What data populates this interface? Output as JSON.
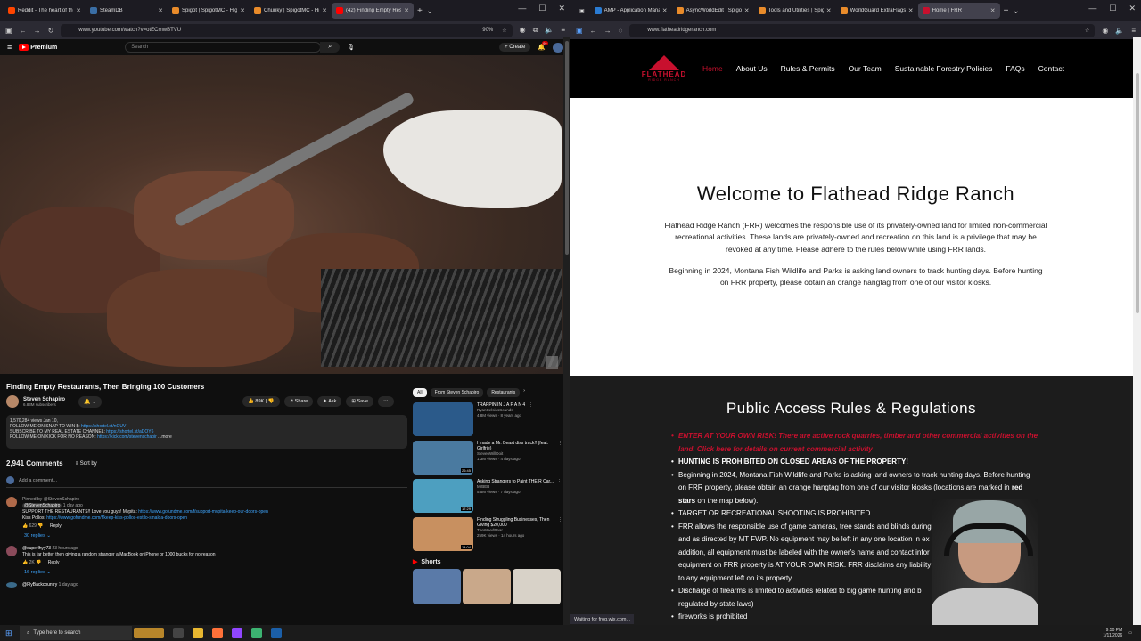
{
  "left_browser": {
    "tabs": [
      {
        "label": "Reddit - The heart of the",
        "color": "#ff4500",
        "active": false
      },
      {
        "label": "SteamDB",
        "color": "#3a6ea5",
        "active": false
      },
      {
        "label": "Spigot | SpigotMC - High",
        "color": "#e98b2a",
        "active": false
      },
      {
        "label": "Chunky | SpigotMC - High",
        "color": "#e98b2a",
        "active": false
      },
      {
        "label": "(42) Finding Empty Resta",
        "color": "#ff0000",
        "active": true
      }
    ],
    "url": "www.youtube.com/watch?v=otECrnwBTVU",
    "zoom": "90%"
  },
  "youtube": {
    "logo": "Premium",
    "search_placeholder": "Search",
    "create": "Create",
    "notif_count": "9+",
    "title": "Finding Empty Restaurants, Then Bringing 100 Customers",
    "channel": "Steven Schapiro",
    "subscribers": "6.83M subscribers",
    "likes": "89K",
    "share": "Share",
    "ask": "Ask",
    "save": "Save",
    "desc_line1": "1,570,284 views  Jan 10,",
    "desc_line2": "FOLLOW ME ON SNAP TO WIN $:",
    "desc_link2": "https://shortel.st/nGUV",
    "desc_line3": "SUBSCRIBE TO MY REAL ESTATE CHANNEL:",
    "desc_link3": "https://shortel.st/aDOY6",
    "desc_line4": "FOLLOW ME ON KICK FOR NO REASON:",
    "desc_link4": "https://kick.com/stevenschapir",
    "more": "...more",
    "comments_count": "2,941 Comments",
    "sort": "Sort by",
    "add_comment": "Add a comment...",
    "comments": [
      {
        "meta": "Pinned by @StevenSchapiro",
        "author": "@StevenSchapiro",
        "time": "1 day ago",
        "text": "SUPPORT THE RESTAURANTS!! Love you guys! Mvpita:",
        "link": "https://www.gofundme.com/f/support-mvpita-keep-our-doors-open",
        "text2": "Kiss Pollos:",
        "link2": "https://www.gofundme.com/f/keep-kiss-pollos-estilo-sinaloa-doors-open",
        "likes": "629",
        "reply": "Reply",
        "replies": "30 replies",
        "color": "#b06a4a"
      },
      {
        "meta": "",
        "author": "@superlhyy73",
        "time": "23 hours ago",
        "text": "This is far better then giving a random stranger a MacBook or iPhone or 1000 bucks for no reason",
        "link": "",
        "text2": "",
        "link2": "",
        "likes": "2K",
        "reply": "Reply",
        "replies": "16 replies",
        "color": "#8a4a5a"
      },
      {
        "meta": "",
        "author": "@FlyBackcountry",
        "time": "1 day ago",
        "text": "",
        "link": "",
        "text2": "",
        "link2": "",
        "likes": "",
        "reply": "",
        "replies": "",
        "color": "#3a6a8a"
      }
    ],
    "chips": [
      "All",
      "From Steven Schapiro",
      "Restaurants"
    ],
    "related": [
      {
        "title": "TRAPPIN IN J A P A N 4",
        "channel": "RyanCelsiusSounds",
        "meta": "4.8M views · 8 years ago",
        "duration": "",
        "color": "#2b5a8a"
      },
      {
        "title": "I made a Mr. Beast diss track!! (feat. Girlfrie)",
        "channel": "StevenWillDoit",
        "meta": "1.3M views · 4 days ago",
        "duration": "26:45",
        "color": "#4a7aa0"
      },
      {
        "title": "Asking Strangers to Paint THEIR Car...",
        "channel": "MrBEB",
        "meta": "5.5M views · 7 days ago",
        "duration": "17:29",
        "color": "#4d9fc0"
      },
      {
        "title": "Finding Struggling Businesses, Then Giving $20,000",
        "channel": "TheWeedBear",
        "meta": "259K views · 14 hours ago",
        "duration": "14:04",
        "color": "#c89060"
      }
    ],
    "shorts_label": "Shorts"
  },
  "right_browser": {
    "tabs": [
      {
        "label": "AMP - Application Mana",
        "color": "#2a7bd3",
        "active": false
      },
      {
        "label": "AsyncWorldEdit | Spigot",
        "color": "#e98b2a",
        "active": false
      },
      {
        "label": "Tools and Utilities | Spigo",
        "color": "#e98b2a",
        "active": false
      },
      {
        "label": "WorldGuard ExtraFlags | S",
        "color": "#e98b2a",
        "active": false
      },
      {
        "label": "Home | FRR",
        "color": "#c8102e",
        "active": true
      }
    ],
    "url": "www.flatheadridgeranch.com",
    "status": "Waiting for frog.wix.com..."
  },
  "site": {
    "logo_text": "FLATHEAD",
    "logo_sub": "RIDGE RANCH",
    "nav": [
      "Home",
      "About Us",
      "Rules & Permits",
      "Our Team",
      "Sustainable Forestry Policies",
      "FAQs",
      "Contact"
    ],
    "hero_title": "Welcome to Flathead Ridge Ranch",
    "hero_p1": "Flathead Ridge Ranch (FRR) welcomes the responsible use of its privately-owned land for limited non-commercial recreational activities. These lands are privately-owned and recreation on this land is a privilege that may be revoked at any time. Please adhere to the rules below while using FRR lands.",
    "hero_p2": "Beginning in 2024, Montana Fish Wildlife and Parks is asking land owners to track hunting days.  Before hunting on FRR property, please obtain an orange hangtag from one of our visitor kiosks.",
    "rules_title": "Public Access Rules & Regulations",
    "rule1": "ENTER AT YOUR OWN RISK! There are active rock quarries, timber and other commercial activities on the land. Click here for details on current commercial activity",
    "rule2": "HUNTING IS PROHIBITED ON CLOSED AREAS OF THE PROPERTY!",
    "rule3a": "Beginning in 2024, Montana Fish Wildlife and Parks is asking land owners to track hunting days.  Before hunting on FRR property, please obtain an orange hangtag from one of our visitor kiosks (locations are marked in ",
    "rule3b": "red stars",
    "rule3c": " on the map below).",
    "rule4": "TARGET OR RECREATIONAL SHOOTING IS PROHIBITED",
    "rule5": "FRR allows the responsible use of game cameras, tree stands and blinds during le",
    "rule5b": "and as directed by MT FWP. No equipment may be left in any one location in ex",
    "rule5c": "addition, all equipment must be labeled with the owner's name and contact infor",
    "rule5d": "equipment on FRR property is AT YOUR OWN RISK. FRR disclaims any liability fo",
    "rule5e": "to any equipment left on its property.",
    "rule6": "Discharge of firearms is limited to activities related to big game hunting and b",
    "rule6b": "regulated by state laws)",
    "rule7": "fireworks is prohibited"
  },
  "taskbar": {
    "search_placeholder": "Type here to search",
    "time": "9:50 PM",
    "date": "1/11/2026"
  }
}
